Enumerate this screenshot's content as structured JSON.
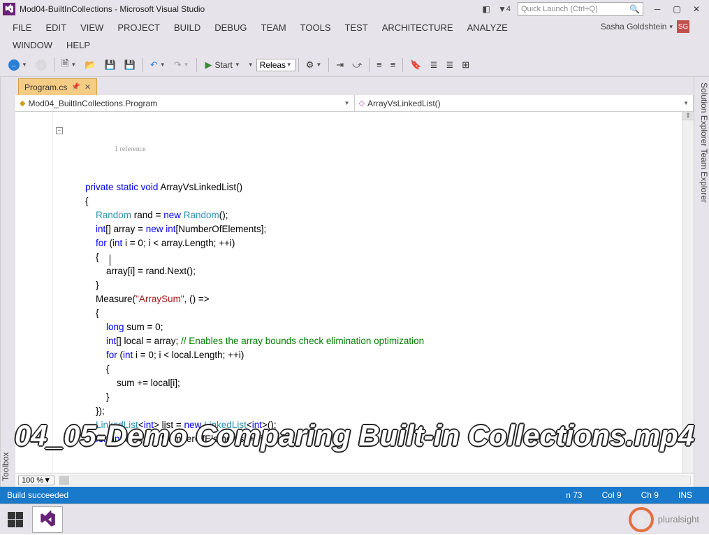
{
  "titlebar": {
    "title": "Mod04-BuiltInCollections - Microsoft Visual Studio",
    "notif_count": "4",
    "quick_launch_placeholder": "Quick Launch (Ctrl+Q)"
  },
  "menu": {
    "items": [
      "FILE",
      "EDIT",
      "VIEW",
      "PROJECT",
      "BUILD",
      "DEBUG",
      "TEAM",
      "TOOLS",
      "TEST",
      "ARCHITECTURE",
      "ANALYZE"
    ],
    "items2": [
      "WINDOW",
      "HELP"
    ],
    "user": "Sasha Goldshtein",
    "user_initials": "SG"
  },
  "toolbar": {
    "start_label": "Start",
    "config": "Releas"
  },
  "left_rail": "Toolbox",
  "right_rail": "Solution Explorer   Team Explorer",
  "tab": {
    "filename": "Program.cs"
  },
  "navbar": {
    "left": "Mod04_BuiltInCollections.Program",
    "right": "ArrayVsLinkedList()"
  },
  "code": {
    "ref_lens": "1 reference",
    "tokens": [
      [
        {
          "t": "        ",
          "c": ""
        },
        {
          "t": "private",
          "c": "kw"
        },
        {
          "t": " ",
          "c": ""
        },
        {
          "t": "static",
          "c": "kw"
        },
        {
          "t": " ",
          "c": ""
        },
        {
          "t": "void",
          "c": "kw"
        },
        {
          "t": " ArrayVsLinkedList()",
          "c": ""
        }
      ],
      [
        {
          "t": "        {",
          "c": ""
        }
      ],
      [
        {
          "t": "            ",
          "c": ""
        },
        {
          "t": "Random",
          "c": "ty"
        },
        {
          "t": " rand = ",
          "c": ""
        },
        {
          "t": "new",
          "c": "kw"
        },
        {
          "t": " ",
          "c": ""
        },
        {
          "t": "Random",
          "c": "ty"
        },
        {
          "t": "();",
          "c": ""
        }
      ],
      [
        {
          "t": "",
          "c": ""
        }
      ],
      [
        {
          "t": "            ",
          "c": ""
        },
        {
          "t": "int",
          "c": "kw"
        },
        {
          "t": "[] array = ",
          "c": ""
        },
        {
          "t": "new",
          "c": "kw"
        },
        {
          "t": " ",
          "c": ""
        },
        {
          "t": "int",
          "c": "kw"
        },
        {
          "t": "[NumberOfElements];",
          "c": ""
        }
      ],
      [
        {
          "t": "            ",
          "c": ""
        },
        {
          "t": "for",
          "c": "kw"
        },
        {
          "t": " (",
          "c": ""
        },
        {
          "t": "int",
          "c": "kw"
        },
        {
          "t": " i = 0; i < array.Length; ++i)",
          "c": ""
        }
      ],
      [
        {
          "t": "            {",
          "c": ""
        }
      ],
      [
        {
          "t": "                array[i] = rand.Next();",
          "c": ""
        }
      ],
      [
        {
          "t": "            }",
          "c": ""
        }
      ],
      [
        {
          "t": "            Measure(",
          "c": ""
        },
        {
          "t": "\"ArraySum\"",
          "c": "st"
        },
        {
          "t": ", () =>",
          "c": ""
        }
      ],
      [
        {
          "t": "            {",
          "c": ""
        }
      ],
      [
        {
          "t": "                ",
          "c": ""
        },
        {
          "t": "long",
          "c": "kw"
        },
        {
          "t": " sum = 0;",
          "c": ""
        }
      ],
      [
        {
          "t": "                ",
          "c": ""
        },
        {
          "t": "int",
          "c": "kw"
        },
        {
          "t": "[] local = array; ",
          "c": ""
        },
        {
          "t": "// Enables the array bounds check elimination optimization",
          "c": "cm"
        }
      ],
      [
        {
          "t": "                ",
          "c": ""
        },
        {
          "t": "for",
          "c": "kw"
        },
        {
          "t": " (",
          "c": ""
        },
        {
          "t": "int",
          "c": "kw"
        },
        {
          "t": " i = 0; i < local.Length; ++i)",
          "c": ""
        }
      ],
      [
        {
          "t": "                {",
          "c": ""
        }
      ],
      [
        {
          "t": "                    sum += local[i];",
          "c": ""
        }
      ],
      [
        {
          "t": "                }",
          "c": ""
        }
      ],
      [
        {
          "t": "            });",
          "c": ""
        }
      ],
      [
        {
          "t": "",
          "c": ""
        }
      ],
      [
        {
          "t": "            ",
          "c": ""
        },
        {
          "t": "LinkedList",
          "c": "ty"
        },
        {
          "t": "<",
          "c": ""
        },
        {
          "t": "int",
          "c": "kw"
        },
        {
          "t": "> list = ",
          "c": ""
        },
        {
          "t": "new",
          "c": "kw"
        },
        {
          "t": " ",
          "c": ""
        },
        {
          "t": "LinkedList",
          "c": "ty"
        },
        {
          "t": "<",
          "c": ""
        },
        {
          "t": "int",
          "c": "kw"
        },
        {
          "t": ">();",
          "c": ""
        }
      ],
      [
        {
          "t": "            ",
          "c": ""
        },
        {
          "t": "for",
          "c": "kw"
        },
        {
          "t": " (",
          "c": ""
        },
        {
          "t": "int",
          "c": "kw"
        },
        {
          "t": " i = 0; i < NumberOfElements; ++i)",
          "c": ""
        }
      ]
    ]
  },
  "zoom": "100 %",
  "status": {
    "build": "Build succeeded",
    "line": "n 73",
    "col": "Col 9",
    "ch": "Ch 9",
    "ins": "INS"
  },
  "overlay": "04_05-Demo Comparing Built-in Collections.mp4",
  "pluralsight": "pluralsight"
}
